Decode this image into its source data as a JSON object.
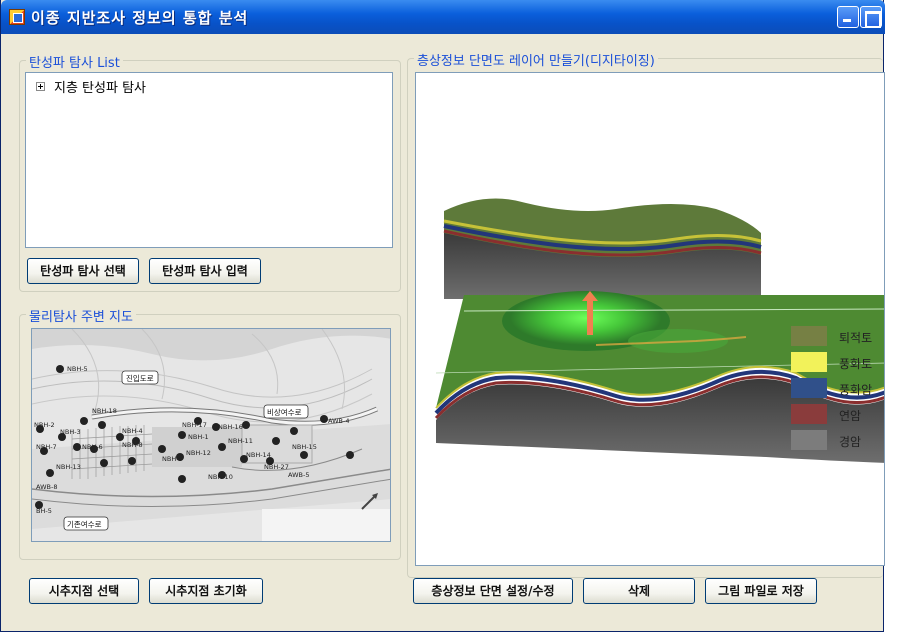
{
  "window": {
    "title": "이종 지반조사 정보의 통합 분석"
  },
  "survey_group": {
    "title": "탄성파 탐사 List",
    "tree_items": [
      "지층 탄성파 탐사"
    ],
    "select_button": "탄성파 탐사 선택",
    "input_button": "탄성파 탐사 입력"
  },
  "map_group": {
    "title": "물리탐사 주변 지도",
    "labels": {
      "road": "진입도로",
      "spillway_emergency": "비상여수로",
      "spillway_existing": "기존여수로",
      "boreholes": [
        "NBH-5",
        "NBH-18",
        "NBH-2",
        "NBH-3",
        "NBH-4",
        "NBH-8",
        "NBH-7",
        "NBH-9",
        "NBH-6",
        "NBH-1",
        "NBH-13",
        "NBH-17",
        "NBH-16",
        "NBH-15",
        "NBH-11",
        "NBH-12",
        "NBH-14",
        "NBH-27",
        "NBH-10",
        "AWB-4",
        "AWB-5",
        "AWB-8",
        "BH-5"
      ]
    },
    "select_button": "시추지점 선택",
    "reset_button": "시추지점 초기화"
  },
  "layer_group": {
    "title": "층상정보 단면도 레이어 만들기(디지타이징)",
    "setup_button": "층상정보 단면 설정/수정",
    "delete_button": "삭제",
    "save_button": "그림 파일로 저장"
  },
  "legend": [
    {
      "label": "퇴적토",
      "color": "#768044"
    },
    {
      "label": "풍화토",
      "color": "#f2f25a"
    },
    {
      "label": "풍화암",
      "color": "#30508a"
    },
    {
      "label": "연암",
      "color": "#8a3c3c"
    },
    {
      "label": "경암",
      "color": "#7c7c7c"
    }
  ]
}
